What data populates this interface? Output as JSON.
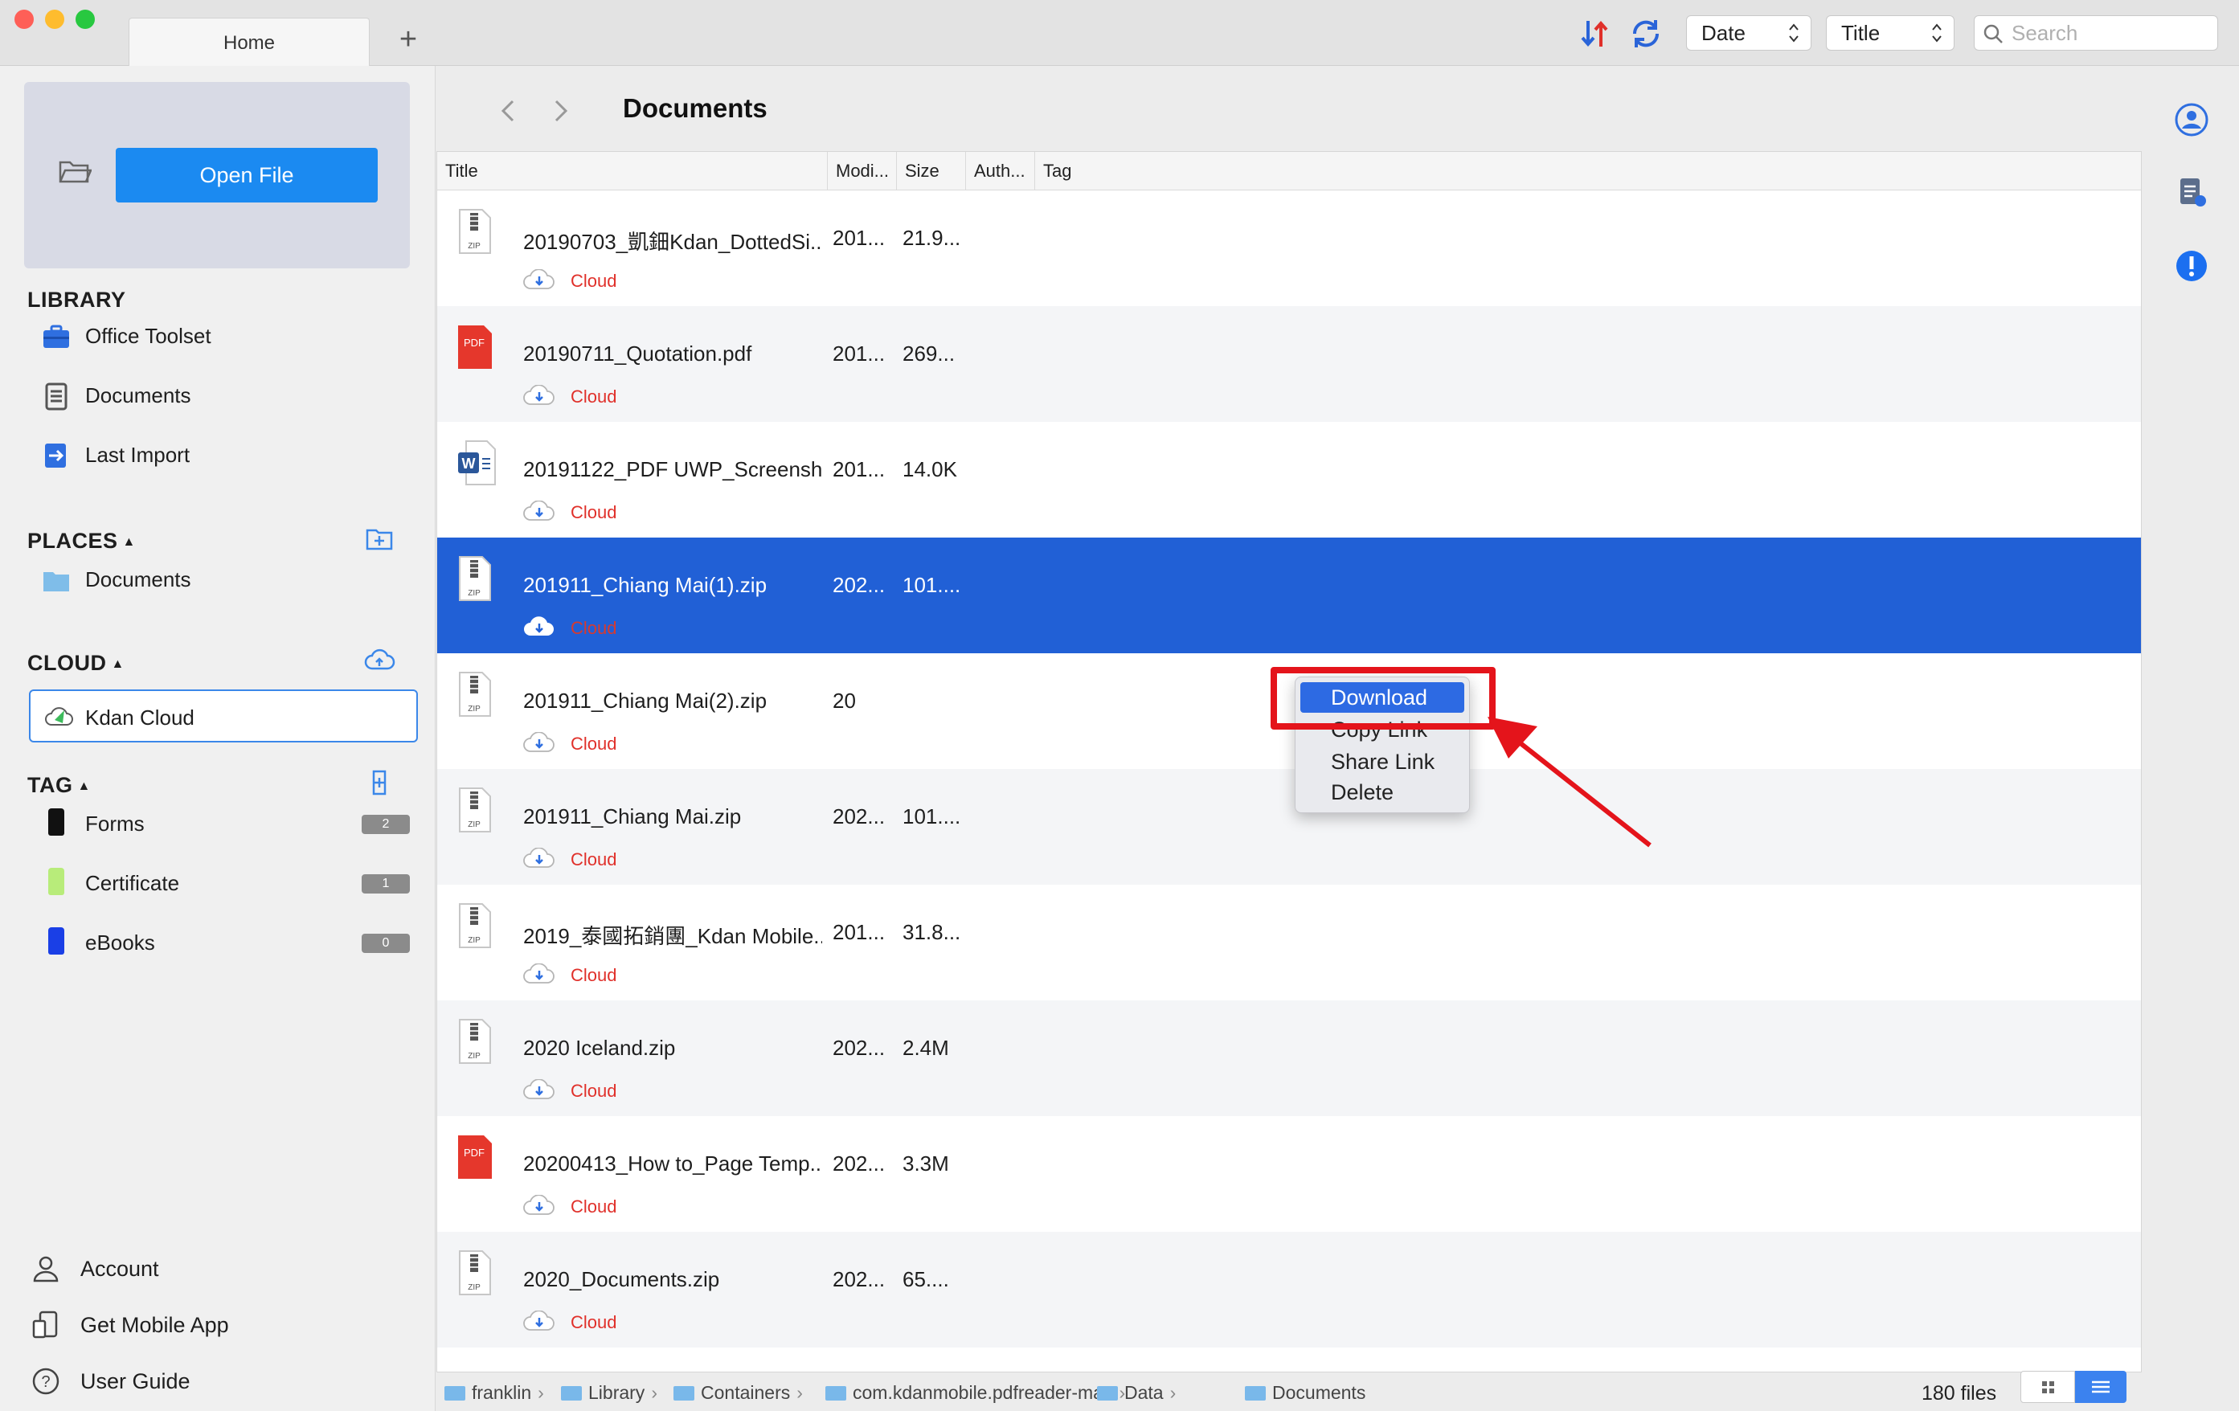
{
  "window": {
    "tab_label": "Home",
    "sort_field": "Date",
    "group_field": "Title",
    "search_placeholder": "Search"
  },
  "sidebar": {
    "open_file_label": "Open File",
    "library_title": "LIBRARY",
    "library_items": [
      "Office Toolset",
      "Documents",
      "Last Import"
    ],
    "places_title": "PLACES",
    "places_items": [
      "Documents"
    ],
    "cloud_title": "CLOUD",
    "cloud_items": [
      "Kdan Cloud"
    ],
    "tag_title": "TAG",
    "tags": [
      {
        "label": "Forms",
        "count": "2",
        "color": "#111111"
      },
      {
        "label": "Certificate",
        "count": "1",
        "color": "#b8ec7a"
      },
      {
        "label": "eBooks",
        "count": "0",
        "color": "#1a3fe6"
      }
    ],
    "bottom_items": [
      "Account",
      "Get Mobile App",
      "User Guide"
    ]
  },
  "main": {
    "title": "Documents",
    "columns": [
      "Title",
      "Modi...",
      "Size",
      "Auth...",
      "Tag"
    ],
    "cloud_label": "Cloud",
    "rows": [
      {
        "name": "20190703_凱鈿Kdan_DottedSi...",
        "modified": "201...",
        "size": "21.9...",
        "type": "zip"
      },
      {
        "name": "20190711_Quotation.pdf",
        "modified": "201...",
        "size": "269...",
        "type": "pdf"
      },
      {
        "name": "20191122_PDF UWP_Screensh...",
        "modified": "201...",
        "size": "14.0K",
        "type": "word"
      },
      {
        "name": "201911_Chiang Mai(1).zip",
        "modified": "202...",
        "size": "101....",
        "type": "zip"
      },
      {
        "name": "201911_Chiang Mai(2).zip",
        "modified": "20",
        "size": "",
        "type": "zip"
      },
      {
        "name": "201911_Chiang Mai.zip",
        "modified": "202...",
        "size": "101....",
        "type": "zip"
      },
      {
        "name": "2019_泰國拓銷團_Kdan Mobile....",
        "modified": "201...",
        "size": "31.8...",
        "type": "zip"
      },
      {
        "name": "2020 Iceland.zip",
        "modified": "202...",
        "size": "2.4M",
        "type": "zip"
      },
      {
        "name": "20200413_How to_Page Temp...",
        "modified": "202...",
        "size": "3.3M",
        "type": "pdf"
      },
      {
        "name": "2020_Documents.zip",
        "modified": "202...",
        "size": "65....",
        "type": "zip"
      }
    ],
    "selected_row": 3,
    "context_menu": [
      "Download",
      "Copy Link",
      "Share Link",
      "Delete"
    ],
    "breadcrumb": [
      "franklin",
      "Library",
      "Containers",
      "com.kdanmobile.pdfreader-mac",
      "Data",
      "Documents"
    ],
    "file_count": "180 files"
  },
  "colors": {
    "accent": "#2160d6",
    "open_button": "#1b8af1",
    "cloud_text": "#e0302a",
    "highlight_annotation": "#e4141b"
  }
}
